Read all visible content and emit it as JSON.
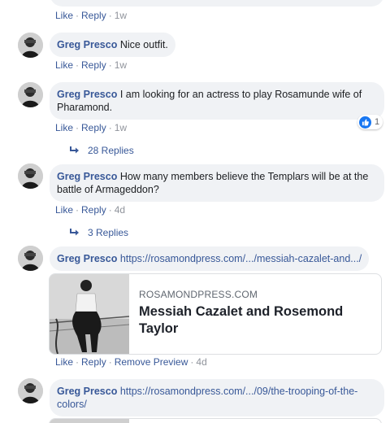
{
  "comments": [
    {
      "actions": {
        "like": "Like",
        "reply": "Reply",
        "time": "1w"
      }
    },
    {
      "author": "Greg Presco",
      "text": "Nice outfit.",
      "actions": {
        "like": "Like",
        "reply": "Reply",
        "time": "1w"
      }
    },
    {
      "author": "Greg Presco",
      "text": "I am looking for an actress to play Rosamunde wife of Pharamond.",
      "actions": {
        "like": "Like",
        "reply": "Reply",
        "time": "1w"
      },
      "reaction_count": "1",
      "replies_label": "28 Replies"
    },
    {
      "author": "Greg Presco",
      "text": "How many members believe the Templars will be at the battle of Armageddon?",
      "actions": {
        "like": "Like",
        "reply": "Reply",
        "time": "4d"
      },
      "replies_label": "3 Replies"
    },
    {
      "author": "Greg Presco",
      "link_text": "https://rosamondpress.com/.../messiah-cazalet-and.../",
      "preview": {
        "site": "ROSAMONDPRESS.COM",
        "title": "Messiah Cazalet and Rosemond Taylor"
      },
      "actions": {
        "like": "Like",
        "reply": "Reply",
        "remove": "Remove Preview",
        "time": "4d"
      }
    },
    {
      "author": "Greg Presco",
      "link_text": "https://rosamondpress.com/.../09/the-trooping-of-the-colors/"
    }
  ],
  "icons": {
    "reply_arrow": "reply-arrow-icon",
    "like_reaction": "like-reaction-icon"
  },
  "colors": {
    "link": "#385898",
    "bubble": "#f0f2f5",
    "muted": "#90949c",
    "reaction": "#1877f2"
  }
}
